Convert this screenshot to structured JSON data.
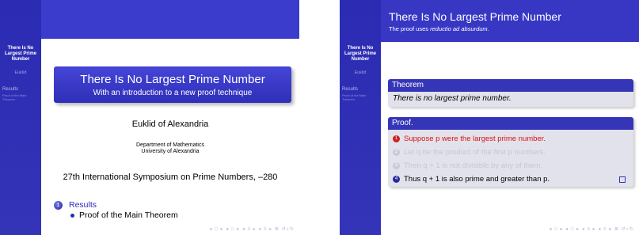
{
  "sidebar": {
    "title": "There Is No Largest Prime Number",
    "author": "Euklid",
    "section": "Results",
    "subsection": "Proof of the Main Theorem"
  },
  "slide1": {
    "title": "There Is No Largest Prime Number",
    "subtitle": "With an introduction to a new proof technique",
    "author": "Euklid of Alexandria",
    "institute_line1": "Department of Mathematics",
    "institute_line2": "University of Alexandria",
    "conference": "27th International Symposium on Prime Numbers, –280",
    "toc": {
      "number": "1",
      "section": "Results",
      "subsection": "Proof of the Main Theorem"
    }
  },
  "slide2": {
    "frame_title": "There Is No Largest Prime Number",
    "frame_subtitle_prefix": "The proof uses",
    "frame_subtitle_emph": "reductio ad absurdum.",
    "theorem_header": "Theorem",
    "theorem_body": "There is no largest prime number.",
    "proof_header": "Proof.",
    "proof_items": [
      {
        "num": "1",
        "text": "Suppose p were the largest prime number."
      },
      {
        "num": "2",
        "text": "Let q be the product of the first p numbers."
      },
      {
        "num": "3",
        "text": "Then q + 1 is not divisible by any of them."
      },
      {
        "num": "4",
        "text": "Thus q + 1 is also prime and greater than p."
      }
    ]
  },
  "navigation_symbols": "◂ □ ▸ ◂ □ ▸ ◂ ≡ ▸ ◂ ≡ ▸ ≣ ↺⌕↻"
}
